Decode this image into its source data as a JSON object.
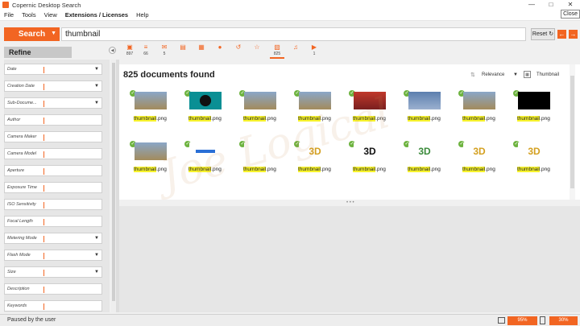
{
  "window": {
    "title": "Copernic Desktop Search",
    "minimize_glyph": "—",
    "maximize_glyph": "□",
    "close_glyph": "✕",
    "close_tooltip": "Close"
  },
  "menu": {
    "items": [
      "File",
      "Tools",
      "View",
      "Extensions / Licenses",
      "Help"
    ]
  },
  "search": {
    "button_label": "Search",
    "query": "thumbnail",
    "reset_label": "Reset",
    "accent_color": "#f26522"
  },
  "filters": {
    "tabs": [
      {
        "icon": "all-documents-icon",
        "count": "897"
      },
      {
        "icon": "list-icon",
        "count": "66"
      },
      {
        "icon": "email-icon",
        "count": "5"
      },
      {
        "icon": "text-file-icon",
        "count": ""
      },
      {
        "icon": "calendar-icon",
        "count": ""
      },
      {
        "icon": "contacts-icon",
        "count": ""
      },
      {
        "icon": "history-icon",
        "count": ""
      },
      {
        "icon": "favorites-icon",
        "count": ""
      },
      {
        "icon": "pictures-icon",
        "count": "825"
      },
      {
        "icon": "music-icon",
        "count": ""
      },
      {
        "icon": "video-icon",
        "count": "1"
      }
    ]
  },
  "refine": {
    "title": "Refine",
    "fields": [
      {
        "label": "Date",
        "dropdown": true
      },
      {
        "label": "Creation Date",
        "dropdown": true
      },
      {
        "label": "Sub-Docume...",
        "dropdown": true
      },
      {
        "label": "Author",
        "dropdown": false
      },
      {
        "label": "Camera Maker",
        "dropdown": false
      },
      {
        "label": "Camera Model",
        "dropdown": false
      },
      {
        "label": "Aperture",
        "dropdown": false
      },
      {
        "label": "Exposure Time",
        "dropdown": false
      },
      {
        "label": "ISO Sensitivity",
        "dropdown": false
      },
      {
        "label": "Focal Length",
        "dropdown": false
      },
      {
        "label": "Metering Mode",
        "dropdown": true
      },
      {
        "label": "Flash Mode",
        "dropdown": true
      },
      {
        "label": "Size",
        "dropdown": true
      },
      {
        "label": "Description",
        "dropdown": false
      },
      {
        "label": "Keywords",
        "dropdown": false
      }
    ]
  },
  "results": {
    "count_label": "825 documents found",
    "sort_label": "Relevance",
    "view_label": "Thumbnail",
    "filename_highlight": "thumbnail",
    "filename_suffix": ".png",
    "row1": [
      "photo-icon",
      "music-app-icon",
      "photo-icon",
      "photo-icon",
      "video-player-icon",
      "question-icon",
      "photo-icon",
      "black-image-icon"
    ],
    "row2": [
      "photo-icon",
      "blue-banner-icon",
      "cartoon-icon",
      "3d-text-icon",
      "3d-text-icon",
      "3d-text-icon",
      "3d-text-icon",
      "3d-text-icon"
    ],
    "row2_text": [
      "",
      "",
      "",
      "3D",
      "3D",
      "3D",
      "3D",
      "3D"
    ],
    "row2_colors": [
      "",
      "",
      "",
      "#d4a020",
      "#111111",
      "#3a8a3a",
      "#d4a020",
      "#d4a020"
    ]
  },
  "status": {
    "text": "Paused by the user",
    "index_progress_label": "95%",
    "index_progress": 0.95,
    "second_progress_label": "30%",
    "second_progress": 0.3
  },
  "watermark": "Joe Logical"
}
